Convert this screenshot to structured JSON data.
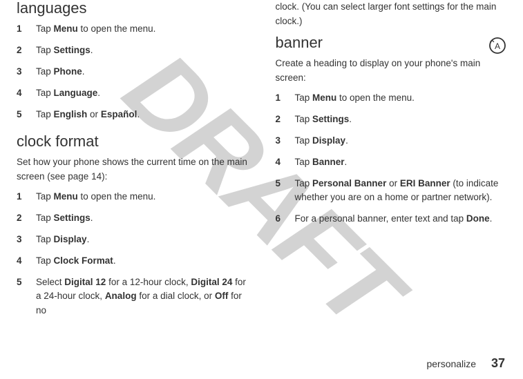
{
  "watermark": "DRAFT",
  "left_col": {
    "sec1": {
      "heading": "languages",
      "steps": [
        {
          "n": "1",
          "pre": "Tap ",
          "bold": "Menu",
          "post": " to open the menu."
        },
        {
          "n": "2",
          "pre": "Tap ",
          "bold": "Settings",
          "post": "."
        },
        {
          "n": "3",
          "pre": "Tap ",
          "bold": "Phone",
          "post": "."
        },
        {
          "n": "4",
          "pre": "Tap ",
          "bold": "Language",
          "post": "."
        },
        {
          "n": "5",
          "pre": "Tap ",
          "bold": "English",
          "mid": " or ",
          "bold2": "Español",
          "post": "."
        }
      ]
    },
    "sec2": {
      "heading": "clock format",
      "intro": "Set how your phone shows the current time on the main screen (see page 14):",
      "steps": [
        {
          "n": "1",
          "pre": "Tap ",
          "bold": "Menu",
          "post": " to open the menu."
        },
        {
          "n": "2",
          "pre": "Tap ",
          "bold": "Settings",
          "post": "."
        },
        {
          "n": "3",
          "pre": "Tap ",
          "bold": "Display",
          "post": "."
        },
        {
          "n": "4",
          "pre": "Tap ",
          "bold": "Clock Format",
          "post": "."
        },
        {
          "n": "5",
          "pre": "Select ",
          "bold": "Digital 12",
          "mid": " for a 12-hour clock, ",
          "bold2": "Digital 24",
          "mid2": " for a 24-hour clock, ",
          "bold3": "Analog",
          "mid3": " for a dial clock, or ",
          "bold4": "Off",
          "post": " for no "
        }
      ]
    }
  },
  "right_col": {
    "continuation": "clock. (You can select larger font settings for the main clock.)",
    "sec1": {
      "heading": "banner",
      "intro": "Create a heading to display on your phone's main screen:",
      "steps": [
        {
          "n": "1",
          "pre": "Tap ",
          "bold": "Menu",
          "post": " to open the menu."
        },
        {
          "n": "2",
          "pre": "Tap ",
          "bold": "Settings",
          "post": "."
        },
        {
          "n": "3",
          "pre": "Tap ",
          "bold": "Display",
          "post": "."
        },
        {
          "n": "4",
          "pre": "Tap ",
          "bold": "Banner",
          "post": "."
        },
        {
          "n": "5",
          "pre": "Tap ",
          "bold": "Personal Banner",
          "mid": " or ",
          "bold2": "ERI Banner",
          "post": " (to indicate whether you are on a home or partner network)."
        },
        {
          "n": "6",
          "pre": "For a personal banner, enter text and tap ",
          "bold": "Done",
          "post": "."
        }
      ]
    }
  },
  "footer": {
    "label": "personalize",
    "page": "37"
  }
}
